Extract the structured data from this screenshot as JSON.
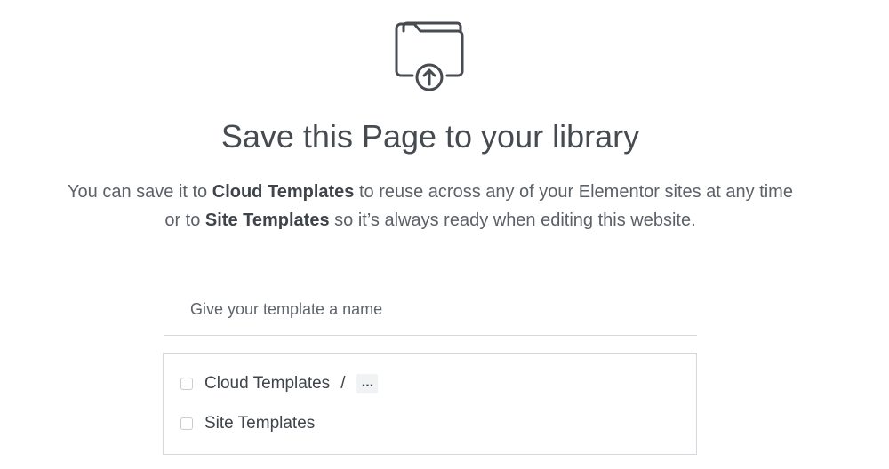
{
  "dialog": {
    "icon": "folder-upload-icon",
    "title": "Save this Page to your library",
    "description": {
      "part1": "You can save it to ",
      "cloud": "Cloud Templates",
      "part2": " to reuse across any of your Elementor sites at any time",
      "part3": "or to ",
      "site": "Site Templates",
      "part4": " so it’s always ready when editing this website."
    }
  },
  "form": {
    "name_placeholder": "Give your template a name",
    "name_value": "",
    "options": {
      "cloud": {
        "label": "Cloud Templates",
        "checked": false,
        "separator": "/",
        "folder_picker": "..."
      },
      "site": {
        "label": "Site Templates",
        "checked": false
      }
    }
  },
  "colors": {
    "text": "#3f444b",
    "muted": "#5c6168",
    "border": "#d5d8dc",
    "picker_bg": "#f1f2f3"
  }
}
